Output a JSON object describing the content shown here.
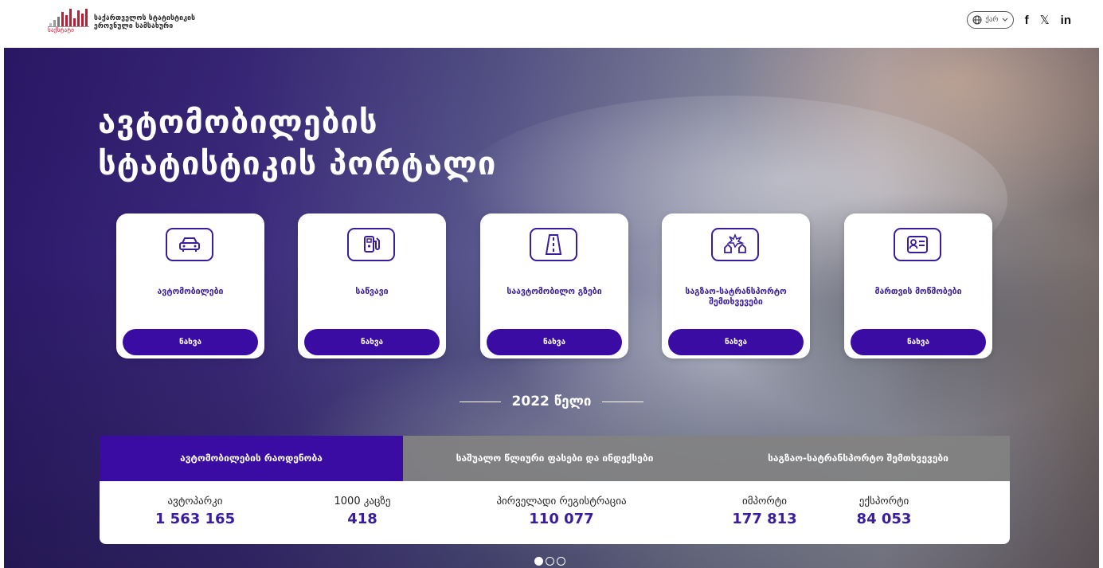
{
  "header": {
    "logo_word": "საქსტატი",
    "logo_line1": "საქართველოს სტატისტიკის",
    "logo_line2": "ეროვნული სამსახური",
    "lang_label": "ქარ",
    "social": [
      "f",
      "𝕏",
      "in"
    ]
  },
  "hero": {
    "title_line1": "ავტომობილების",
    "title_line2": "სტატისტიკის პორტალი"
  },
  "cards": [
    {
      "label": "ავტომობილები",
      "button": "ნახვა",
      "icon": "car-icon"
    },
    {
      "label": "საწვავი",
      "button": "ნახვა",
      "icon": "fuel-pump-icon"
    },
    {
      "label": "საავტომობილო გზები",
      "button": "ნახვა",
      "icon": "road-icon"
    },
    {
      "label": "საგზაო-სატრანსპორტო შემთხვევები",
      "button": "ნახვა",
      "icon": "car-crash-icon"
    },
    {
      "label": "მართვის მოწმობები",
      "button": "ნახვა",
      "icon": "id-card-icon"
    }
  ],
  "year_label": "2022 წელი",
  "tabs": [
    {
      "label": "ავტომობილების რაოდენობა",
      "active": true
    },
    {
      "label": "საშუალო წლიური ფასები და ინდექსები",
      "active": false
    },
    {
      "label": "საგზაო-სატრანსპორტო შემთხვევები",
      "active": false
    }
  ],
  "stats": [
    {
      "label": "ავტოპარკი",
      "value": "1 563 165"
    },
    {
      "label": "1000 კაცზე",
      "value": "418"
    },
    {
      "label": "პირველადი რეგისტრაცია",
      "value": "110 077"
    },
    {
      "label": "იმპორტი",
      "value": "177 813"
    },
    {
      "label": "ექსპორტი",
      "value": "84 053"
    }
  ],
  "pager": {
    "count": 3,
    "active_index": 0
  },
  "colors": {
    "primary": "#3a0ca3",
    "accent_text": "#3a1d9e",
    "logo_red": "#b3122b"
  }
}
